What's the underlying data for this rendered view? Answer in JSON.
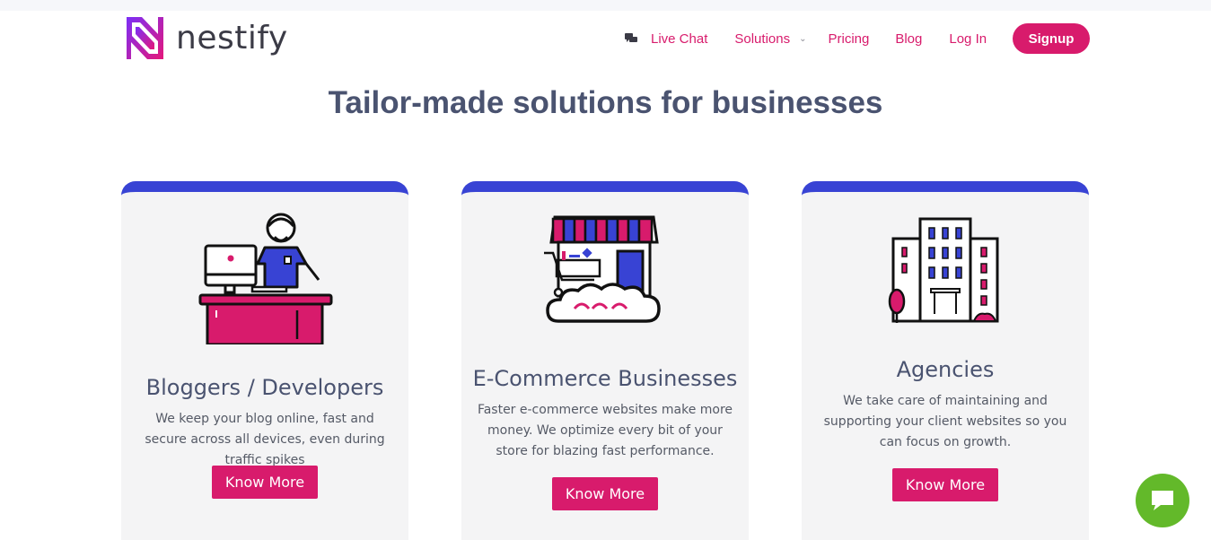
{
  "brand": {
    "name": "nestify"
  },
  "nav": {
    "live_chat": "Live Chat",
    "solutions": "Solutions",
    "pricing": "Pricing",
    "blog": "Blog",
    "login": "Log In",
    "signup": "Signup"
  },
  "headline": "Tailor-made solutions for businesses",
  "cards": [
    {
      "title": "Bloggers / Developers",
      "description": "We keep your blog online, fast and secure across all devices, even during traffic spikes",
      "button": "Know More",
      "icon": "developer-at-desk-icon"
    },
    {
      "title": "E-Commerce Businesses",
      "description": "Faster e-commerce websites make more money. We optimize every bit of your store for blazing fast performance.",
      "button": "Know More",
      "icon": "storefront-cart-icon"
    },
    {
      "title": "Agencies",
      "description": "We take care of maintaining and supporting your client websites so you can focus on growth.",
      "button": "Know More",
      "icon": "office-building-icon"
    }
  ],
  "colors": {
    "accent": "#d81b6c",
    "card_top": "#3843d4",
    "headline": "#4a5370",
    "chat_widget": "#63b92a"
  }
}
